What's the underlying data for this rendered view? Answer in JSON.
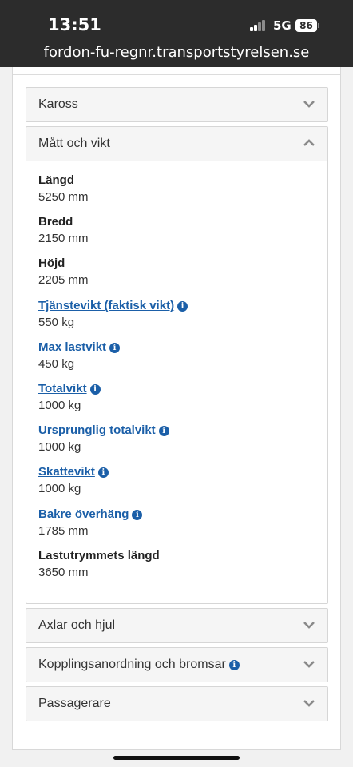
{
  "status_bar": {
    "time": "13:51",
    "network": "5G",
    "battery": "86"
  },
  "browser": {
    "url": "fordon-fu-regnr.transportstyrelsen.se"
  },
  "sections": {
    "kaross": {
      "title": "Kaross"
    },
    "matt": {
      "title": "Mått och vikt"
    },
    "axlar": {
      "title": "Axlar och hjul"
    },
    "koppling": {
      "title": "Kopplingsanordning och bromsar"
    },
    "passagerare": {
      "title": "Passagerare"
    }
  },
  "fields": [
    {
      "label": "Längd",
      "value": "5250 mm",
      "link": false,
      "info": false
    },
    {
      "label": "Bredd",
      "value": "2150 mm",
      "link": false,
      "info": false
    },
    {
      "label": "Höjd",
      "value": "2205 mm",
      "link": false,
      "info": false
    },
    {
      "label": "Tjänstevikt (faktisk vikt)",
      "value": "550 kg",
      "link": true,
      "info": true
    },
    {
      "label": "Max lastvikt",
      "value": "450 kg",
      "link": true,
      "info": true
    },
    {
      "label": "Totalvikt",
      "value": "1000 kg",
      "link": true,
      "info": true
    },
    {
      "label": "Ursprunglig totalvikt",
      "value": "1000 kg",
      "link": true,
      "info": true
    },
    {
      "label": "Skattevikt",
      "value": "1000 kg",
      "link": true,
      "info": true
    },
    {
      "label": "Bakre överhäng",
      "value": "1785 mm",
      "link": true,
      "info": true
    },
    {
      "label": "Lastutrymmets längd",
      "value": "3650 mm",
      "link": false,
      "info": false
    }
  ],
  "colors": {
    "link": "#1b5fa8",
    "status_bar": "#2c2c2c",
    "header_bg": "#f5f5f5"
  },
  "icons": {
    "chevron_down": "chevron-down-icon",
    "chevron_up": "chevron-up-icon",
    "info": "info-icon"
  },
  "info_glyph": "i"
}
